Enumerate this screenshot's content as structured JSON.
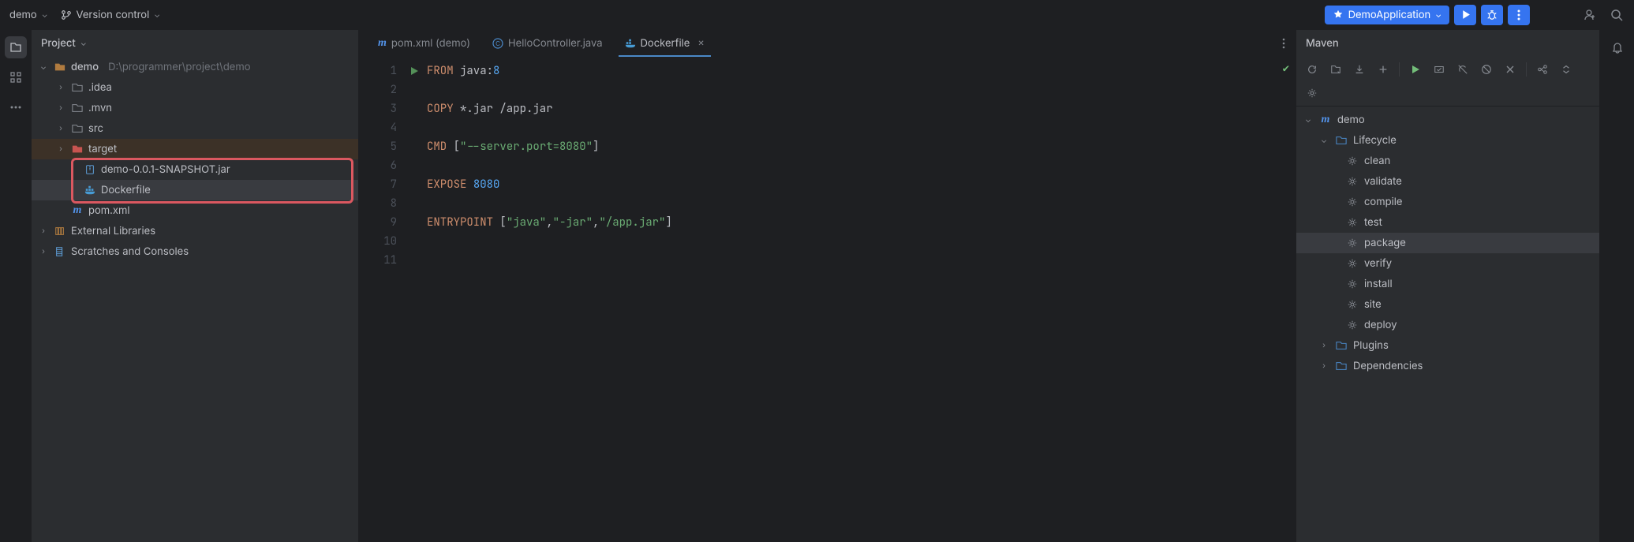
{
  "topbar": {
    "project_dd": "demo",
    "vcs_dd": "Version control",
    "run_config": "DemoApplication"
  },
  "project_panel": {
    "title": "Project",
    "root": {
      "name": "demo",
      "path": "D:\\programmer\\project\\demo"
    },
    "nodes": {
      "idea": ".idea",
      "mvn": ".mvn",
      "src": "src",
      "target": "target",
      "jar": "demo-0.0.1-SNAPSHOT.jar",
      "dockerfile": "Dockerfile",
      "pom": "pom.xml",
      "ext": "External Libraries",
      "scratch": "Scratches and Consoles"
    }
  },
  "tabs": {
    "pom": "pom.xml (demo)",
    "ctrl": "HelloController.java",
    "docker": "Dockerfile"
  },
  "editor": {
    "lines": [
      {
        "num": 1,
        "tokens": [
          [
            "kw",
            "FROM "
          ],
          [
            "tok",
            "java"
          ],
          [
            "tok",
            ":"
          ],
          [
            "num",
            "8"
          ]
        ],
        "run": true
      },
      {
        "num": 2,
        "tokens": []
      },
      {
        "num": 3,
        "tokens": [
          [
            "kw",
            "COPY "
          ],
          [
            "tok",
            "*.jar /app.jar"
          ]
        ]
      },
      {
        "num": 4,
        "tokens": []
      },
      {
        "num": 5,
        "tokens": [
          [
            "kw",
            "CMD "
          ],
          [
            "tok",
            "["
          ],
          [
            "str",
            "\"--server.port=8080\""
          ],
          [
            "tok",
            "]"
          ]
        ]
      },
      {
        "num": 6,
        "tokens": []
      },
      {
        "num": 7,
        "tokens": [
          [
            "kw",
            "EXPOSE "
          ],
          [
            "num",
            "8080"
          ]
        ]
      },
      {
        "num": 8,
        "tokens": []
      },
      {
        "num": 9,
        "tokens": [
          [
            "kw",
            "ENTRYPOINT "
          ],
          [
            "tok",
            "["
          ],
          [
            "str",
            "\"java\""
          ],
          [
            "tok",
            ","
          ],
          [
            "str",
            "\"-jar\""
          ],
          [
            "tok",
            ","
          ],
          [
            "str",
            "\"/app.jar\""
          ],
          [
            "tok",
            "]"
          ]
        ]
      },
      {
        "num": 10,
        "tokens": []
      },
      {
        "num": 11,
        "tokens": []
      }
    ]
  },
  "maven": {
    "title": "Maven",
    "root": "demo",
    "lifecycle_label": "Lifecycle",
    "goals": [
      "clean",
      "validate",
      "compile",
      "test",
      "package",
      "verify",
      "install",
      "site",
      "deploy"
    ],
    "selected_goal": "package",
    "plugins": "Plugins",
    "deps": "Dependencies"
  }
}
